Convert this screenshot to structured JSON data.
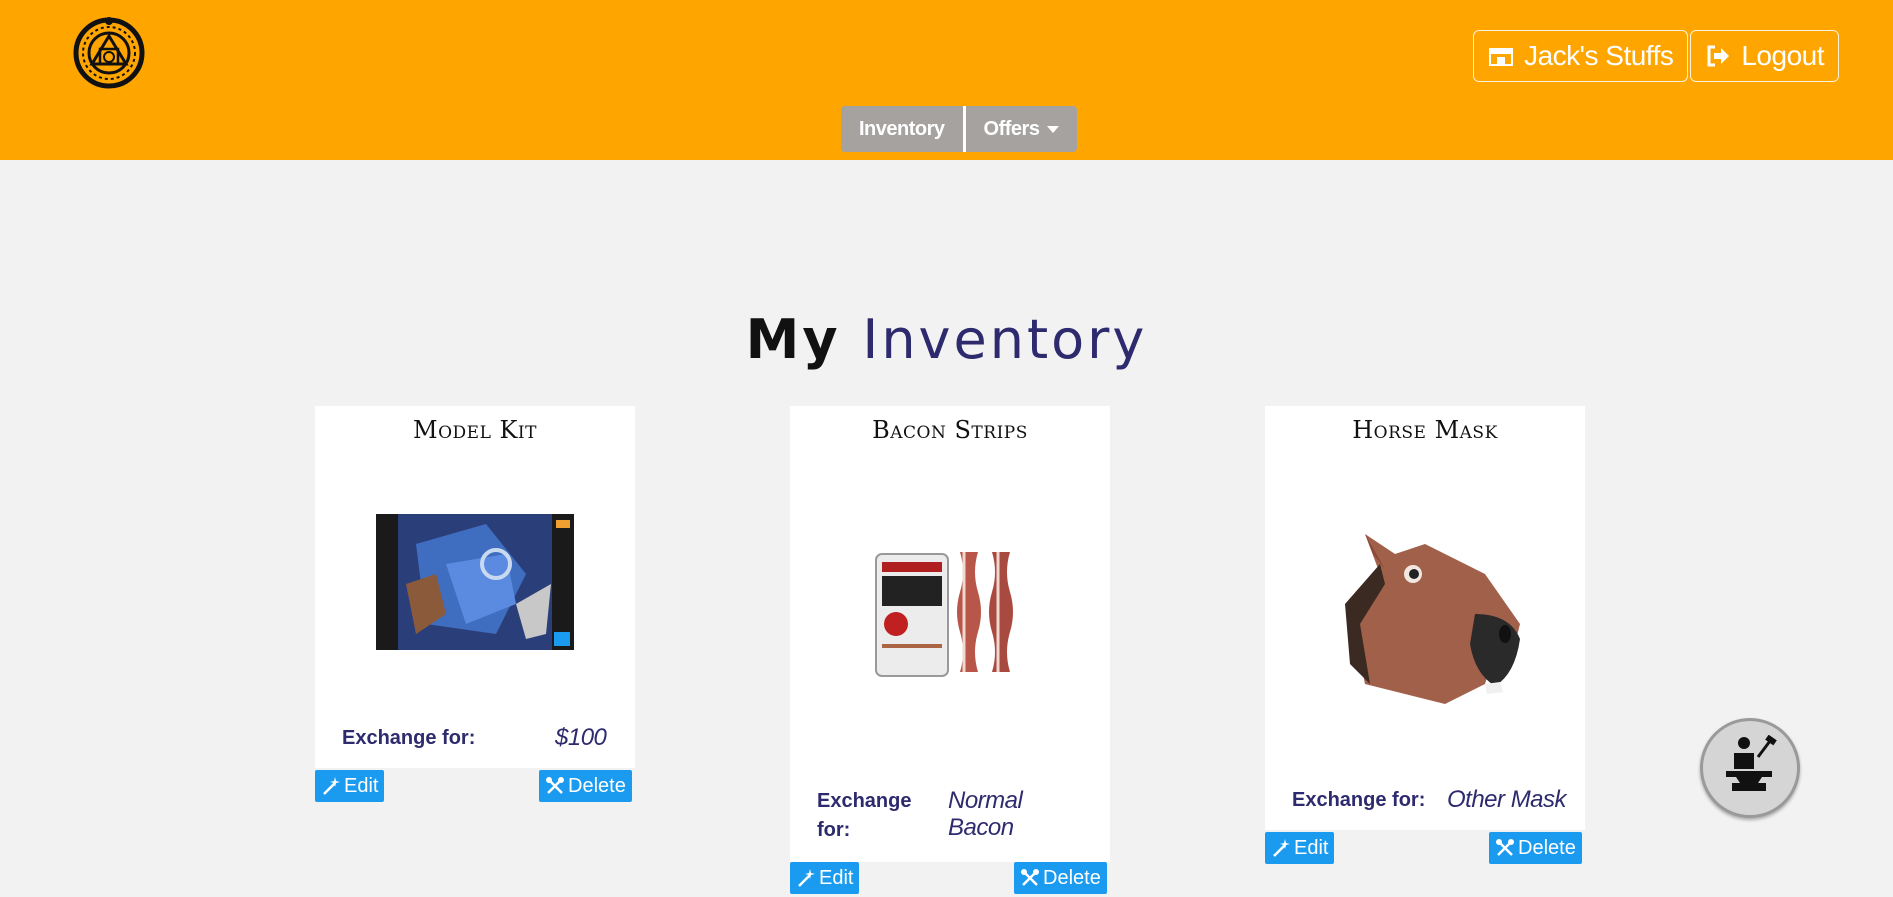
{
  "header": {
    "user_label": "Jack's Stuffs",
    "logout_label": "Logout",
    "nav": {
      "inventory_label": "Inventory",
      "offers_label": "Offers"
    },
    "accent_color": "#ffa500"
  },
  "main": {
    "title_part1": "My",
    "title_part2": "Inventory"
  },
  "cards": [
    {
      "title": "Model Kit",
      "exchange_label": "Exchange for:",
      "exchange_value": "$100",
      "edit_label": "Edit",
      "delete_label": "Delete",
      "image": "model-kit-box-image"
    },
    {
      "title": "Bacon Strips",
      "exchange_label_l1": "Exchange",
      "exchange_label_l2": "for:",
      "exchange_value_l1": "Normal",
      "exchange_value_l2": "Bacon",
      "edit_label": "Edit",
      "delete_label": "Delete",
      "image": "bacon-bandages-tin-image"
    },
    {
      "title": "Horse Mask",
      "exchange_label": "Exchange for:",
      "exchange_value": "Other Mask",
      "edit_label": "Edit",
      "delete_label": "Delete",
      "image": "horse-mask-image"
    }
  ],
  "fab": {
    "icon": "blacksmith-anvil-icon"
  },
  "colors": {
    "button_blue": "#1a9bef",
    "text_navy": "#2d2a6e",
    "nav_gray": "#a5a2a0"
  }
}
